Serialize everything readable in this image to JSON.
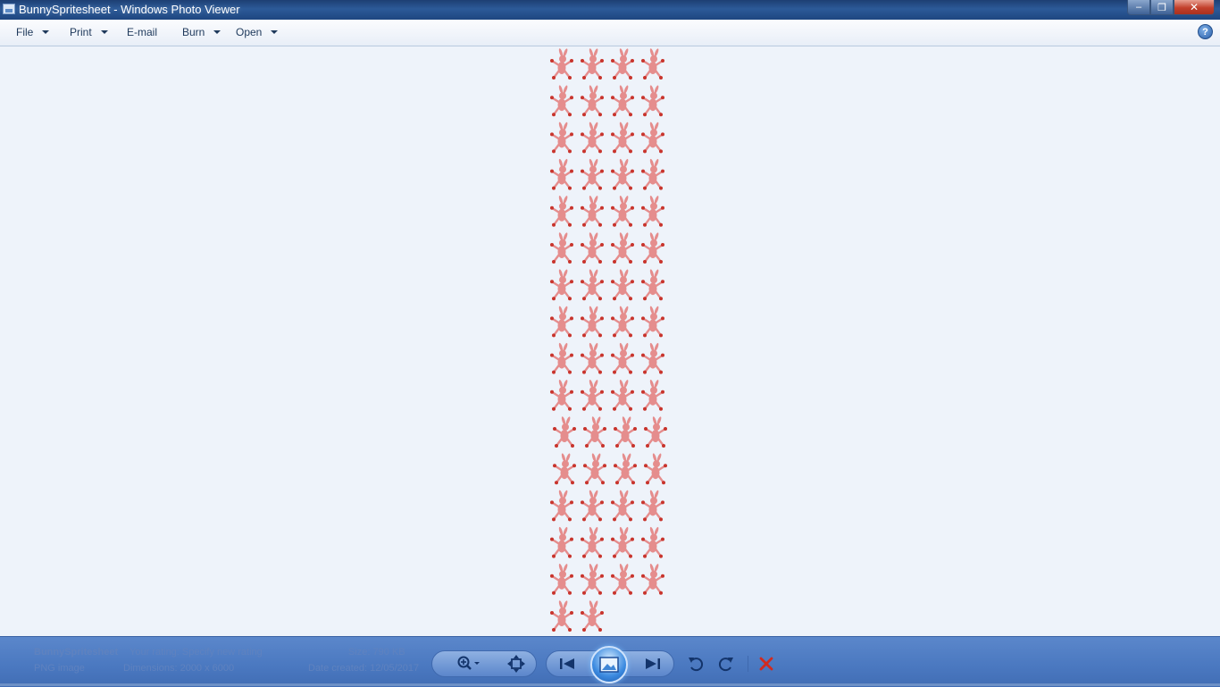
{
  "window": {
    "title": "BunnySpritesheet - Windows Photo Viewer",
    "controls": {
      "minimize": "–",
      "maximize": "❐",
      "close": "✕"
    }
  },
  "menu": {
    "items": [
      {
        "label": "File",
        "has_dropdown": true
      },
      {
        "label": "Print",
        "has_dropdown": true
      },
      {
        "label": "E-mail",
        "has_dropdown": false
      },
      {
        "label": "Burn",
        "has_dropdown": true
      },
      {
        "label": "Open",
        "has_dropdown": true
      }
    ],
    "help": "?"
  },
  "image": {
    "sprite_columns": 4,
    "rows_full": 15,
    "last_row_count": 2,
    "sprite_color": "#e58d8d",
    "sprite_accent": "#c8342c"
  },
  "status": {
    "filename": "BunnySpritesheet",
    "rating": "Your rating: Specify new rating",
    "file_type": "PNG image",
    "dimensions": "Dimensions: 2000 x 6000",
    "size": "Size: 790 KB",
    "date": "Date created: 12/05/2017"
  },
  "toolbar": {
    "zoom_icon": "zoom-icon",
    "actual_size_icon": "fit-window-icon",
    "previous_icon": "previous-icon",
    "slideshow_icon": "slideshow-icon",
    "next_icon": "next-icon",
    "rotate_ccw_icon": "rotate-counterclockwise-icon",
    "rotate_cw_icon": "rotate-clockwise-icon",
    "delete_icon": "delete-icon"
  },
  "colors": {
    "titlebar": "#2c5a98",
    "bottombar": "#4a78c0",
    "canvas": "#eef3fa",
    "delete": "#d12a1f"
  }
}
